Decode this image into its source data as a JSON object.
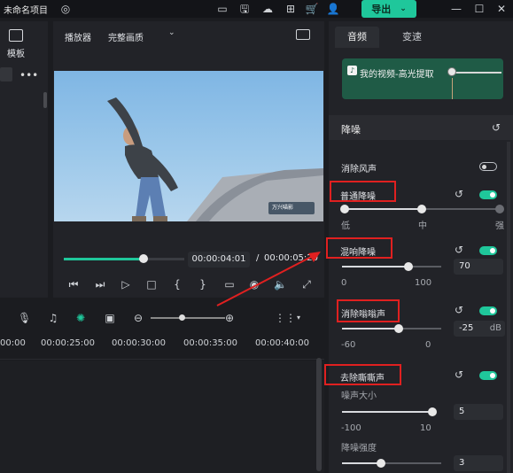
{
  "titlebar": {
    "app_title": "未命名项目",
    "export_label": "导出"
  },
  "left_panel": {
    "template_label": "模板"
  },
  "player": {
    "label": "播放器",
    "quality": "完整画质",
    "watermark": "万兴喵影",
    "time_current": "00:00:04:01",
    "time_separator": "/",
    "time_total": "00:00:05:20",
    "progress": 0.66
  },
  "timeline": {
    "ruler": [
      "00:00",
      "00:00:25:00",
      "00:00:30:00",
      "00:00:35:00",
      "00:00:40:00"
    ]
  },
  "right_panel": {
    "tabs": [
      "音频",
      "变速"
    ],
    "clip_name": "我的视频-高光提取",
    "section_title": "降噪",
    "wind_noise": {
      "label": "消除风声",
      "enabled": false
    },
    "normal_denoise": {
      "label": "普通降噪",
      "enabled": true,
      "low": "低",
      "mid": "中",
      "high": "强",
      "level": 0.5
    },
    "reverb": {
      "label": "混响降噪",
      "enabled": true,
      "value": "70",
      "min": "0",
      "max": "100"
    },
    "hum": {
      "label": "消除嗡嗡声",
      "enabled": true,
      "value": "-25",
      "unit": "dB",
      "min": "-60",
      "max": "0"
    },
    "hiss": {
      "label": "去除嘶嘶声",
      "enabled": true,
      "size_label": "噪声大小",
      "size_value": "5",
      "size_min": "-100",
      "size_max": "10",
      "strength_label": "降噪强度",
      "strength_value": "3"
    }
  },
  "colors": {
    "accent": "#1fc79b",
    "highlight": "#e02020",
    "card": "#1f5b46"
  }
}
